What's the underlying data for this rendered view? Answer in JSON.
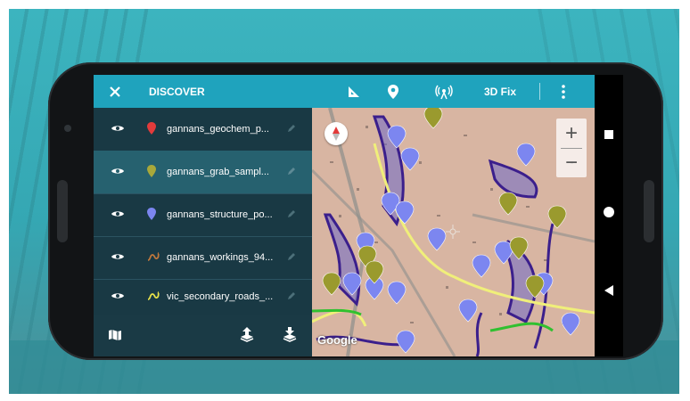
{
  "toolbar": {
    "title": "DISCOVER",
    "gps_status": "3D Fix",
    "icons": [
      "close-icon",
      "ruler-icon",
      "location-pin-icon",
      "gps-antenna-icon",
      "overflow-menu-icon"
    ]
  },
  "layers": [
    {
      "name": "gannans_geochem_p...",
      "icon": "pin-icon",
      "color": "#e23b3b",
      "visible": true,
      "selected": false
    },
    {
      "name": "gannans_grab_sampl...",
      "icon": "pin-icon",
      "color": "#a8a83a",
      "visible": true,
      "selected": true
    },
    {
      "name": "gannans_structure_po...",
      "icon": "pin-icon",
      "color": "#7c86f0",
      "visible": true,
      "selected": false
    },
    {
      "name": "gannans_workings_94...",
      "icon": "polyline-icon",
      "color": "#c0783c",
      "visible": true,
      "selected": false
    },
    {
      "name": "vic_secondary_roads_...",
      "icon": "polyline-icon",
      "color": "#e8e24a",
      "visible": true,
      "selected": false
    }
  ],
  "map": {
    "attribution": "Google",
    "zoom_in": "+",
    "zoom_out": "−"
  },
  "colors": {
    "toolbar": "#1fa3bd",
    "panel": "#193944",
    "selected_row": "#26616f",
    "marker_blue": "#7c86f0",
    "marker_olive": "#9a9a2e",
    "polygon_purple": "#4b2a96",
    "road_yellow": "#f0ef7a",
    "road_green": "#30c030"
  }
}
